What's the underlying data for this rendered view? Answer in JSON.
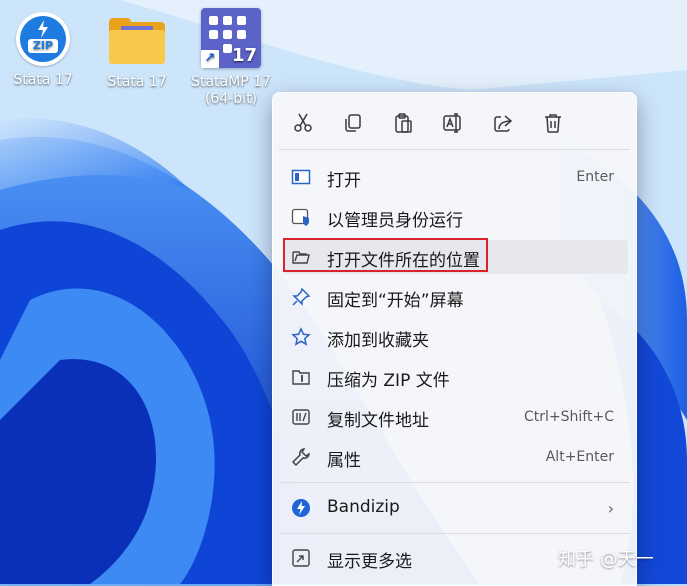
{
  "desktop": {
    "icons": [
      {
        "label": "Stata 17",
        "icon": "bandizip-zip-icon"
      },
      {
        "label": "Stata 17",
        "icon": "folder-icon"
      },
      {
        "label": "StataMP 17",
        "label2": "(64-bit)",
        "icon": "stata-shortcut-icon",
        "badge": "17",
        "arrow": "↗"
      }
    ]
  },
  "context_menu": {
    "toolbar": [
      {
        "name": "cut",
        "icon": "scissors-icon"
      },
      {
        "name": "copy",
        "icon": "copy-icon"
      },
      {
        "name": "paste",
        "icon": "paste-icon"
      },
      {
        "name": "rename",
        "icon": "rename-icon"
      },
      {
        "name": "share",
        "icon": "share-icon"
      },
      {
        "name": "delete",
        "icon": "trash-icon"
      }
    ],
    "items": [
      {
        "label": "打开",
        "shortcut": "Enter",
        "icon": "window-icon"
      },
      {
        "label": "以管理员身份运行",
        "shortcut": "",
        "icon": "admin-shield-icon"
      },
      {
        "label": "打开文件所在的位置",
        "shortcut": "",
        "icon": "folder-open-icon",
        "highlighted": true
      },
      {
        "label": "固定到“开始”屏幕",
        "shortcut": "",
        "icon": "pin-icon"
      },
      {
        "label": "添加到收藏夹",
        "shortcut": "",
        "icon": "star-icon"
      },
      {
        "label": "压缩为 ZIP 文件",
        "shortcut": "",
        "icon": "zip-folder-icon"
      },
      {
        "label": "复制文件地址",
        "shortcut": "Ctrl+Shift+C",
        "icon": "path-icon"
      },
      {
        "label": "属性",
        "shortcut": "Alt+Enter",
        "icon": "wrench-icon"
      },
      {
        "label": "Bandizip",
        "shortcut": "",
        "icon": "bandizip-icon",
        "submenu": "›"
      },
      {
        "label": "显示更多选",
        "shortcut": "",
        "icon": "more-options-icon"
      }
    ],
    "highlight_color": "#d8232a"
  },
  "watermark": "知乎 @天一"
}
